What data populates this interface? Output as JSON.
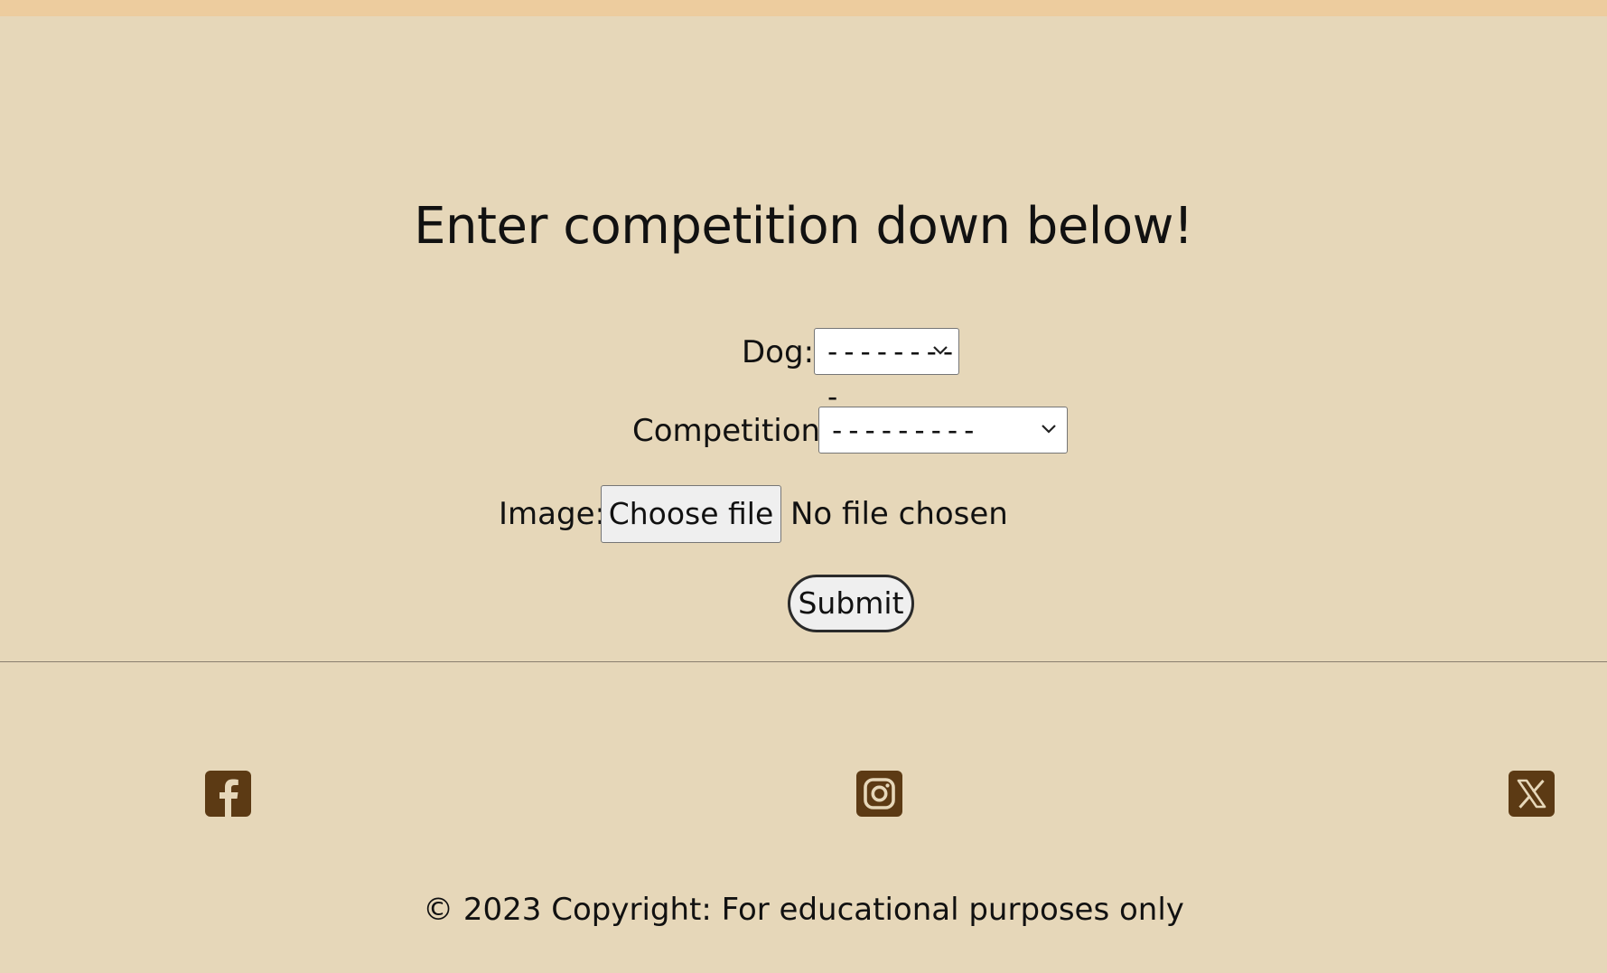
{
  "form": {
    "heading": "Enter competition down below!",
    "dog_label": "Dog:",
    "dog_value": "---------",
    "competition_label": "Competition:",
    "competition_value": "---------",
    "image_label": "Image:",
    "choose_file_label": "Choose file",
    "no_file_text": "No file chosen",
    "submit_label": "Submit"
  },
  "footer": {
    "social_icons": [
      "facebook-icon",
      "instagram-icon",
      "x-twitter-icon"
    ],
    "copyright": "© 2023 Copyright: For educational purposes only"
  },
  "colors": {
    "background": "#e6d7b9",
    "top_bar": "#edcc9e",
    "icon_brown": "#5c3a14"
  }
}
